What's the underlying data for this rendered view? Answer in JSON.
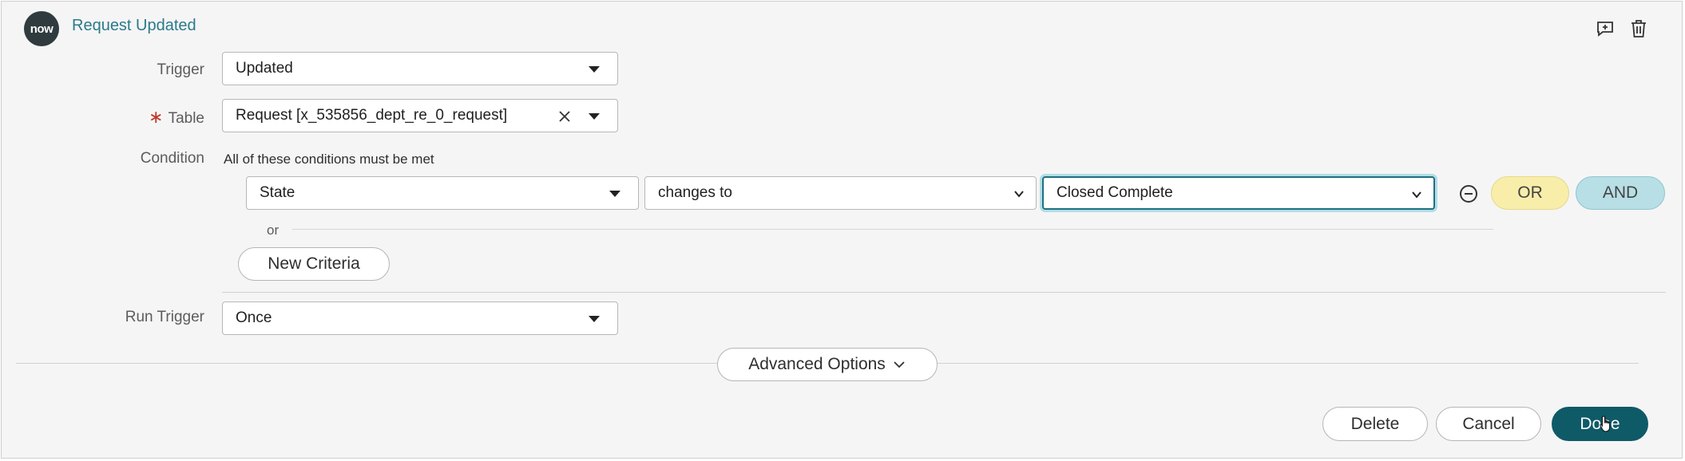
{
  "header": {
    "logo_text": "now",
    "title": "Request Updated",
    "icons": [
      "add-comment-icon",
      "trash-icon"
    ]
  },
  "trigger": {
    "label": "Trigger",
    "value": "Updated"
  },
  "table": {
    "label": "Table",
    "required_mark": "∗",
    "value": "Request [x_535856_dept_re_0_request]"
  },
  "condition": {
    "label": "Condition",
    "description": "All of these conditions must be met",
    "field": "State",
    "operator": "changes to",
    "value": "Closed Complete",
    "or_button": "OR",
    "and_button": "AND",
    "or_separator": "or",
    "new_criteria_button": "New Criteria"
  },
  "run_trigger": {
    "label": "Run Trigger",
    "value": "Once"
  },
  "advanced_options_label": "Advanced Options",
  "footer": {
    "delete_label": "Delete",
    "cancel_label": "Cancel",
    "done_label": "Done"
  },
  "colors": {
    "accent": "#0f5a67",
    "title": "#2b7a8c",
    "or": "#f8eeaa",
    "and": "#b8dfe6"
  }
}
